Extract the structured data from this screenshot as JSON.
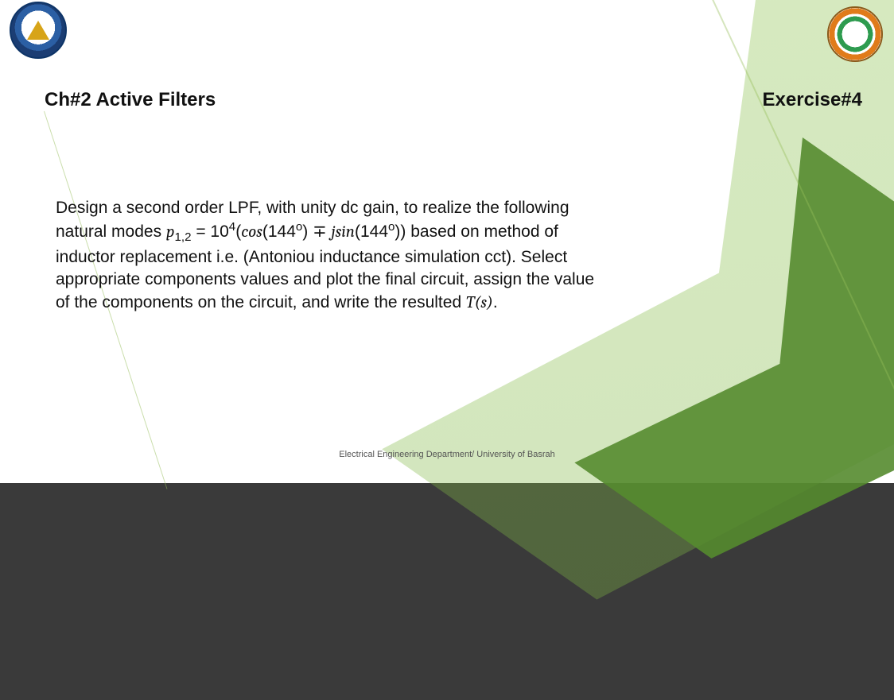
{
  "header": {
    "chapter": "Ch#2 Active Filters",
    "exercise": "Exercise#4"
  },
  "problem": {
    "line1": "Design a second order LPF, with unity dc gain, to realize the following",
    "line2a": "natural modes   ",
    "eq": {
      "var": "p",
      "sub": "1,2",
      "eq": " = 10",
      "exp": "4",
      "open": "(",
      "cos": "cos",
      "lp1": "(144",
      "dg": "o",
      "rp1": ") ∓ ",
      "jsin": "jsin",
      "lp2": "(144",
      "dg2": "o",
      "rp2": ")",
      "close": ")"
    },
    "line2b": " based on method of",
    "line3": "inductor replacement i.e. (Antoniou inductance simulation cct). Select",
    "line4": "appropriate components values and plot the final circuit, assign the value",
    "line5a": "of the components on the circuit, and write the resulted ",
    "Ts": "T(s)",
    "line5b": "."
  },
  "footer": "Electrical Engineering Department/ University of Basrah",
  "logos": {
    "left": "university-of-basrah-logo",
    "right": "college-of-engineering-logo"
  }
}
